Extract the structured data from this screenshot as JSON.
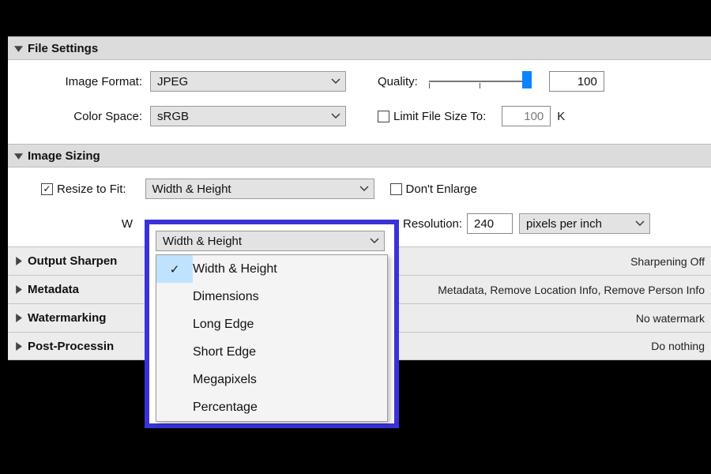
{
  "file_settings": {
    "title": "File Settings",
    "image_format_label": "Image Format:",
    "image_format_value": "JPEG",
    "quality_label": "Quality:",
    "quality_value": "100",
    "color_space_label": "Color Space:",
    "color_space_value": "sRGB",
    "limit_file_size_label": "Limit File Size To:",
    "limit_file_size_value": "100",
    "limit_file_size_unit": "K",
    "limit_file_size_checked": false
  },
  "image_sizing": {
    "title": "Image Sizing",
    "resize_to_fit_label": "Resize to Fit:",
    "resize_to_fit_checked": true,
    "resize_mode_value": "Width & Height",
    "dont_enlarge_label": "Don't Enlarge",
    "dont_enlarge_checked": false,
    "w_label": "W",
    "resolution_label": "Resolution:",
    "resolution_value": "240",
    "resolution_unit": "pixels per inch",
    "dropdown_options": [
      "Width & Height",
      "Dimensions",
      "Long Edge",
      "Short Edge",
      "Megapixels",
      "Percentage"
    ],
    "dropdown_selected_index": 0
  },
  "sections": {
    "output_sharpening": {
      "title": "Output Sharpen",
      "summary": "Sharpening Off"
    },
    "metadata": {
      "title": "Metadata",
      "summary": "Metadata, Remove Location Info, Remove Person Info"
    },
    "watermarking": {
      "title": "Watermarking",
      "summary": "No watermark"
    },
    "post_processing": {
      "title": "Post-Processin",
      "summary": "Do nothing"
    }
  }
}
